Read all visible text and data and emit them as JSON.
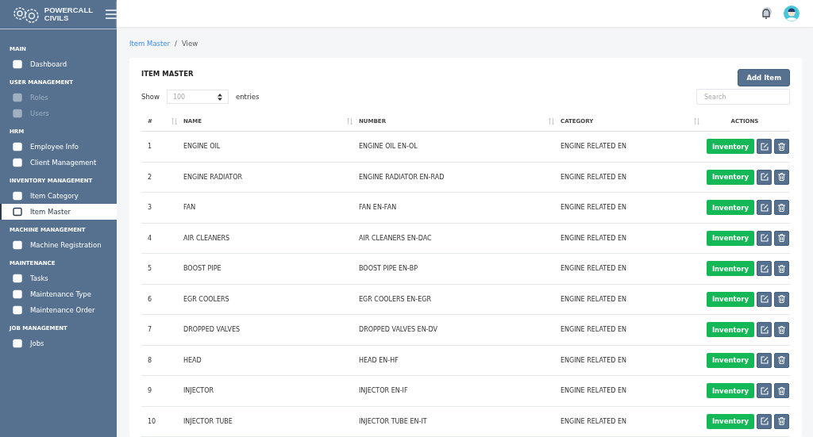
{
  "brand": {
    "line1": "POWERCALL",
    "line2": "CIVILS"
  },
  "sidebar": {
    "sections": [
      {
        "title": "MAIN",
        "items": [
          {
            "label": "Dashboard",
            "selected": false,
            "disabled": false
          }
        ]
      },
      {
        "title": "USER MANAGEMENT",
        "items": [
          {
            "label": "Roles",
            "selected": false,
            "disabled": true
          },
          {
            "label": "Users",
            "selected": false,
            "disabled": true
          }
        ]
      },
      {
        "title": "HRM",
        "items": [
          {
            "label": "Employee Info",
            "selected": false,
            "disabled": false
          },
          {
            "label": "Client Management",
            "selected": false,
            "disabled": false
          }
        ]
      },
      {
        "title": "INVENTORY MANAGEMENT",
        "items": [
          {
            "label": "Item Category",
            "selected": false,
            "disabled": false
          },
          {
            "label": "Item Master",
            "selected": true,
            "disabled": false
          }
        ]
      },
      {
        "title": "MACHINE MANAGEMENT",
        "items": [
          {
            "label": "Machine Registration",
            "selected": false,
            "disabled": false
          }
        ]
      },
      {
        "title": "MAINTENANCE",
        "items": [
          {
            "label": "Tasks",
            "selected": false,
            "disabled": false
          },
          {
            "label": "Maintenance Type",
            "selected": false,
            "disabled": false
          },
          {
            "label": "Maintenance Order",
            "selected": false,
            "disabled": false
          }
        ]
      },
      {
        "title": "JOB MANAGEMENT",
        "items": [
          {
            "label": "Jobs",
            "selected": false,
            "disabled": false
          }
        ]
      }
    ]
  },
  "breadcrumb": {
    "separator": "/",
    "items": [
      {
        "label": "Item Master",
        "link": true
      },
      {
        "label": "View",
        "link": false
      }
    ]
  },
  "card": {
    "title": "ITEM MASTER",
    "add_button": "Add Item",
    "show_label": "Show",
    "page_size": "100",
    "entries_label": "entries",
    "search": {
      "placeholder": "Search"
    }
  },
  "table": {
    "columns": [
      {
        "label": "#",
        "sortable": true
      },
      {
        "label": "NAME",
        "sortable": true
      },
      {
        "label": "NUMBER",
        "sortable": true
      },
      {
        "label": "CATEGORY",
        "sortable": true
      },
      {
        "label": "ACTIONS",
        "sortable": false
      }
    ],
    "rows": [
      {
        "n": "1",
        "name": "ENGINE OIL",
        "number": "ENGINE OIL EN-OL",
        "category": "ENGINE RELATED EN",
        "action": "Inventory"
      },
      {
        "n": "2",
        "name": "ENGINE RADIATOR",
        "number": "ENGINE RADIATOR EN-RAD",
        "category": "ENGINE RELATED EN",
        "action": "Inventory"
      },
      {
        "n": "3",
        "name": "FAN",
        "number": "FAN EN-FAN",
        "category": "ENGINE RELATED EN",
        "action": "Inventory"
      },
      {
        "n": "4",
        "name": "AIR CLEANERS",
        "number": "AIR CLEANERS EN-DAC",
        "category": "ENGINE RELATED EN",
        "action": "Inventory"
      },
      {
        "n": "5",
        "name": "BOOST PIPE",
        "number": "BOOST PIPE EN-BP",
        "category": "ENGINE RELATED EN",
        "action": "Inventory"
      },
      {
        "n": "6",
        "name": "EGR COOLERS",
        "number": "EGR COOLERS EN-EGR",
        "category": "ENGINE RELATED EN",
        "action": "Inventory"
      },
      {
        "n": "7",
        "name": "DROPPED VALVES",
        "number": "DROPPED VALVES EN-DV",
        "category": "ENGINE RELATED EN",
        "action": "Inventory"
      },
      {
        "n": "8",
        "name": "HEAD",
        "number": "HEAD EN-HF",
        "category": "ENGINE RELATED EN",
        "action": "Inventory"
      },
      {
        "n": "9",
        "name": "INJECTOR",
        "number": "INJECTOR EN-IF",
        "category": "ENGINE RELATED EN",
        "action": "Inventory"
      },
      {
        "n": "10",
        "name": "INJECTOR TUBE",
        "number": "INJECTOR TUBE EN-IT",
        "category": "ENGINE RELATED EN",
        "action": "Inventory"
      }
    ]
  }
}
